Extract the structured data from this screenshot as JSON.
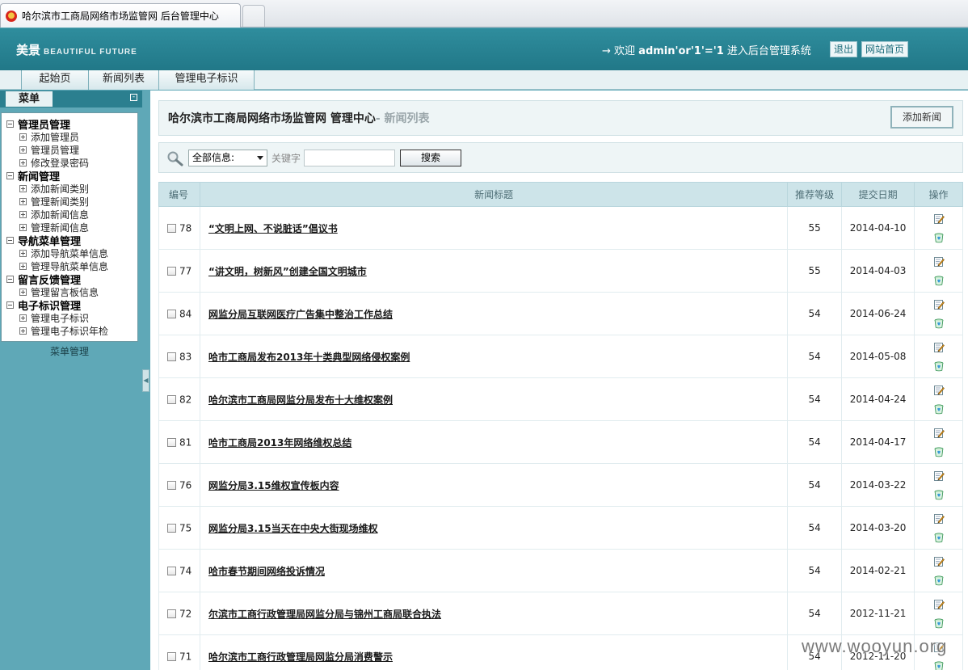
{
  "browser": {
    "tab_title": "哈尔滨市工商局网络市场监管网 后台管理中心"
  },
  "header": {
    "logo_cn": "美景",
    "logo_en": "BEAUTIFUL FUTURE",
    "welcome_prefix": "→ 欢迎 ",
    "welcome_user": "admin'or'1'='1",
    "welcome_suffix": " 进入后台管理系统",
    "logout_label": "退出",
    "home_label": "网站首页"
  },
  "nav": {
    "tabs": [
      {
        "label": "起始页"
      },
      {
        "label": "新闻列表"
      },
      {
        "label": "管理电子标识"
      }
    ]
  },
  "sidebar": {
    "title": "菜单",
    "footer": "菜单管理",
    "groups": [
      {
        "label": "管理员管理",
        "items": [
          "添加管理员",
          "管理员管理",
          "修改登录密码"
        ]
      },
      {
        "label": "新闻管理",
        "items": [
          "添加新闻类别",
          "管理新闻类别",
          "添加新闻信息",
          "管理新闻信息"
        ]
      },
      {
        "label": "导航菜单管理",
        "items": [
          "添加导航菜单信息",
          "管理导航菜单信息"
        ]
      },
      {
        "label": "留言反馈管理",
        "items": [
          "管理留言板信息"
        ]
      },
      {
        "label": "电子标识管理",
        "items": [
          "管理电子标识",
          "管理电子标识年检"
        ]
      }
    ]
  },
  "main": {
    "title": "哈尔滨市工商局网络市场监管网 管理中心",
    "subtitle": "- 新闻列表",
    "add_button": "添加新闻",
    "search": {
      "select_value": "全部信息:",
      "keyword_label": "关键字",
      "keyword_value": "",
      "button": "搜索"
    },
    "table": {
      "headers": [
        "编号",
        "新闻标题",
        "推荐等级",
        "提交日期",
        "操作"
      ],
      "rows": [
        {
          "id": "78",
          "title": "“文明上网、不说脏话”倡议书",
          "rank": "55",
          "date": "2014-04-10"
        },
        {
          "id": "77",
          "title": "“讲文明，树新风”创建全国文明城市",
          "rank": "55",
          "date": "2014-04-03"
        },
        {
          "id": "84",
          "title": "网监分局互联网医疗广告集中整治工作总结",
          "rank": "54",
          "date": "2014-06-24"
        },
        {
          "id": "83",
          "title": "哈市工商局发布2013年十类典型网络侵权案例",
          "rank": "54",
          "date": "2014-05-08"
        },
        {
          "id": "82",
          "title": "哈尔滨市工商局网监分局发布十大维权案例",
          "rank": "54",
          "date": "2014-04-24"
        },
        {
          "id": "81",
          "title": "哈市工商局2013年网络维权总结",
          "rank": "54",
          "date": "2014-04-17"
        },
        {
          "id": "76",
          "title": "网监分局3.15维权宣传板内容",
          "rank": "54",
          "date": "2014-03-22"
        },
        {
          "id": "75",
          "title": "网监分局3.15当天在中央大街现场维权",
          "rank": "54",
          "date": "2014-03-20"
        },
        {
          "id": "74",
          "title": "哈市春节期间网络投诉情况",
          "rank": "54",
          "date": "2014-02-21"
        },
        {
          "id": "72",
          "title": "尔滨市工商行政管理局网监分局与锦州工商局联合执法",
          "rank": "54",
          "date": "2012-11-21"
        },
        {
          "id": "71",
          "title": "哈尔滨市工商行政管理局网监分局消费警示",
          "rank": "54",
          "date": "2012-11-20"
        }
      ]
    }
  },
  "watermark": "www.wooyun.org"
}
